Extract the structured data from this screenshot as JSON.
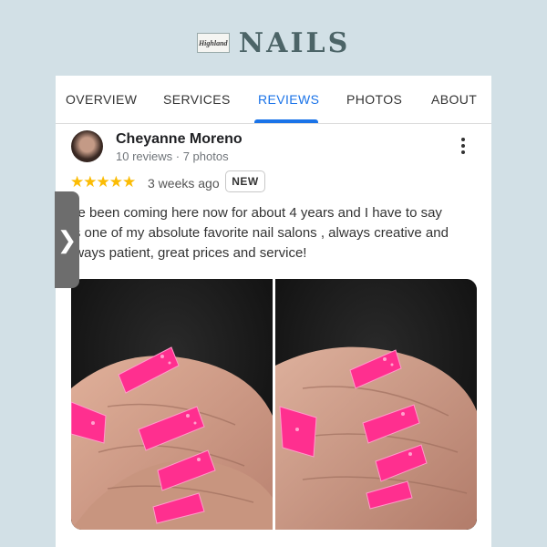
{
  "brand": {
    "logo_text": "Highland",
    "name": "NAILS"
  },
  "tabs": [
    {
      "label": "OVERVIEW"
    },
    {
      "label": "SERVICES"
    },
    {
      "label": "REVIEWS",
      "active": true
    },
    {
      "label": "PHOTOS"
    },
    {
      "label": "ABOUT"
    }
  ],
  "review": {
    "reviewer_name": "Cheyanne Moreno",
    "reviewer_meta": "10 reviews · 7 photos",
    "rating": 5,
    "stars": "★★★★★",
    "time": "3 weeks ago",
    "badge": "NEW",
    "text_lines": [
      "ve been coming here now for about 4 years and I have to say",
      "'s one of my absolute favorite nail salons , always creative and",
      "lways patient, great prices and service!"
    ]
  },
  "side_handle": {
    "icon": "chevron-right-icon",
    "glyph": "❯"
  },
  "colors": {
    "background": "#d2e0e6",
    "accent": "#1a73e8",
    "star": "#fbbc04",
    "brand_text": "#4c6467"
  }
}
